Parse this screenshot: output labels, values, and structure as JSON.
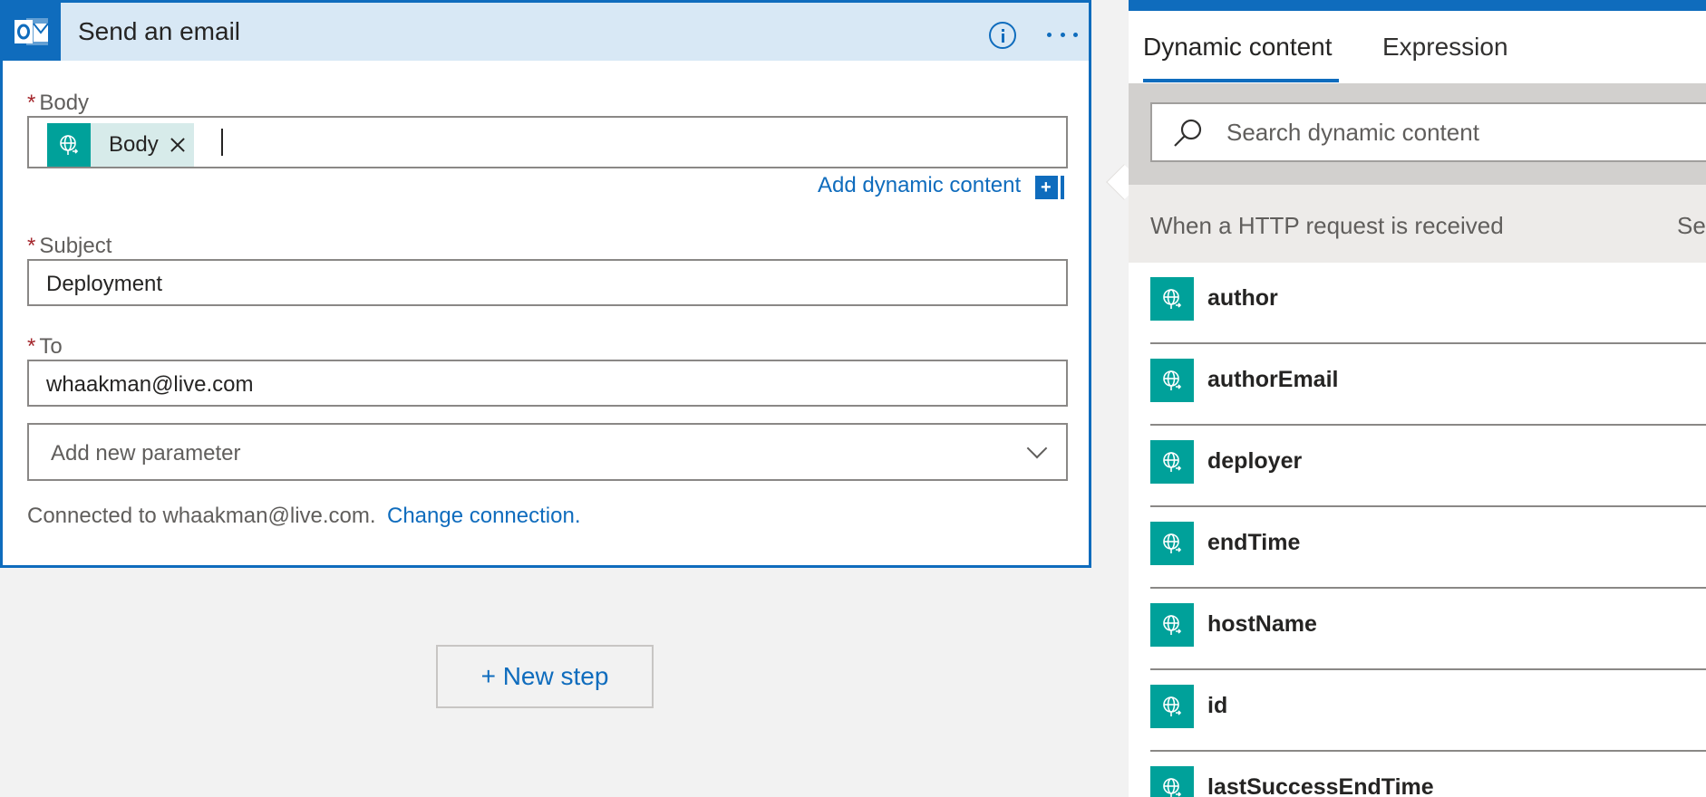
{
  "card": {
    "title": "Send an email",
    "fields": {
      "body": {
        "required_mark": "*",
        "label": "Body",
        "token": "Body"
      },
      "subject": {
        "required_mark": "*",
        "label": "Subject",
        "value": "Deployment"
      },
      "to": {
        "required_mark": "*",
        "label": "To",
        "value": "whaakman@live.com"
      }
    },
    "add_dynamic_content": "Add dynamic content",
    "add_dynamic_content_button": "+",
    "add_parameter_placeholder": "Add new parameter",
    "connected_text": "Connected to whaakman@live.com.",
    "change_connection": "Change connection."
  },
  "new_step": {
    "label": "+ New step"
  },
  "panel": {
    "tabs": [
      {
        "label": "Dynamic content",
        "active": true
      },
      {
        "label": "Expression",
        "active": false
      }
    ],
    "search_placeholder": "Search dynamic content",
    "section_title": "When a HTTP request is received",
    "section_action": "Se",
    "items": [
      {
        "label": "author",
        "icon": "http-globe-icon"
      },
      {
        "label": "authorEmail",
        "icon": "http-globe-icon"
      },
      {
        "label": "deployer",
        "icon": "http-globe-icon"
      },
      {
        "label": "endTime",
        "icon": "http-globe-icon"
      },
      {
        "label": "hostName",
        "icon": "http-globe-icon"
      },
      {
        "label": "id",
        "icon": "http-globe-icon"
      },
      {
        "label": "lastSuccessEndTime",
        "icon": "http-globe-icon"
      }
    ]
  },
  "colors": {
    "accent": "#0f6cbd",
    "header_bg": "#d8e8f5",
    "token_icon": "#00a19a",
    "required": "#a4262c"
  }
}
